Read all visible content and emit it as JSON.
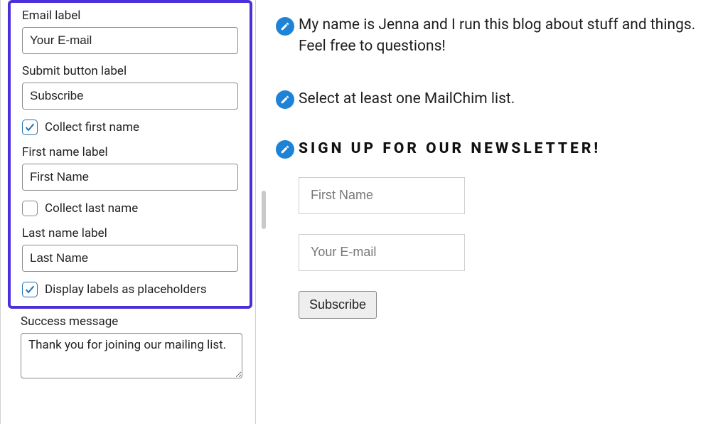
{
  "settings": {
    "email_label_title": "Email label",
    "email_label_value": "Your E-mail",
    "submit_label_title": "Submit button label",
    "submit_label_value": "Subscribe",
    "collect_first_name_label": "Collect first name",
    "first_name_label_title": "First name label",
    "first_name_label_value": "First Name",
    "collect_last_name_label": "Collect last name",
    "last_name_label_title": "Last name label",
    "last_name_label_value": "Last Name",
    "display_placeholders_label": "Display labels as placeholders",
    "success_title": "Success message",
    "success_value": "Thank you for joining our mailing list."
  },
  "preview": {
    "bio": "My name is Jenna and I run this blog about stuff and things. Feel free to questions!",
    "warning": "Select at least one MailChim list.",
    "newsletter_title": "Sign up for our newsletter!",
    "first_name_placeholder": "First Name",
    "email_placeholder": "Your E-mail",
    "subscribe_label": "Subscribe"
  }
}
